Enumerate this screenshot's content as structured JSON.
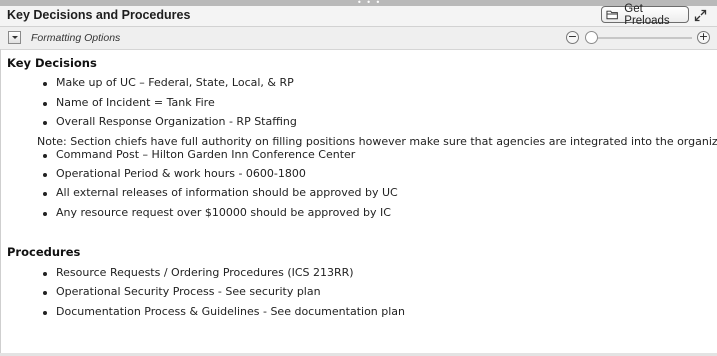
{
  "header": {
    "title": "Key Decisions and Procedures",
    "get_preloads_label": "Get Preloads"
  },
  "toolbar": {
    "formatting_label": "Formatting Options",
    "zoom_minus": "−",
    "zoom_plus": "+",
    "zoom_level": 0
  },
  "key_decisions": {
    "heading": "Key Decisions",
    "items": [
      "Make up of UC – Federal, State, Local, & RP",
      "Name of Incident = Tank  Fire",
      "Overall Response Organization - RP Staffing"
    ],
    "note": "Note: Section chiefs have full authority on filling positions however make sure that agencies are integrated into the organization.",
    "items_after_note": [
      "Command Post – Hilton Garden Inn Conference Center",
      "Operational Period & work hours - 0600-1800",
      "All external releases of information should be approved by UC",
      "Any resource request over $10000 should be approved by IC"
    ]
  },
  "procedures": {
    "heading": "Procedures",
    "items": [
      "Resource Requests / Ordering Procedures (ICS 213RR)",
      "Operational Security Process - See security plan",
      "Documentation Process & Guidelines - See documentation plan"
    ]
  },
  "icons": {
    "preloads": "folder-icon",
    "expand": "expand-arrows-icon",
    "dropdown": "chevron-down-icon",
    "grip": "drag-grip-icon"
  }
}
